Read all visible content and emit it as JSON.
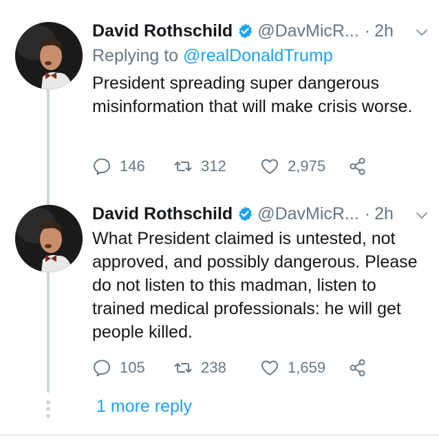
{
  "tweets": [
    {
      "author_name": "David Rothschild",
      "handle": "@DavMicR...",
      "separator": "·",
      "time": "2h",
      "replying_prefix": "Replying to ",
      "replying_to": "@realDonaldTrump",
      "text": "President spreading super dangerous misinformation that will make crisis worse.",
      "replies": "146",
      "retweets": "312",
      "likes": "2,975"
    },
    {
      "author_name": "David Rothschild",
      "handle": "@DavMicR...",
      "separator": "·",
      "time": "2h",
      "text": "What President claimed is untested, not approved, and possibly dangerous. Please do not listen to this madman, listen to trained medical professionals: he will get people killed.",
      "replies": "105",
      "retweets": "238",
      "likes": "1,659"
    }
  ],
  "more_replies_label": "1 more reply",
  "colors": {
    "link_blue": "#1da1f2",
    "secondary_gray": "#657786",
    "text_dark": "#14171a",
    "thread_line": "#ccd6dd"
  },
  "icons": [
    "verified-badge-icon",
    "chevron-down-icon",
    "reply-icon",
    "retweet-icon",
    "like-icon",
    "share-icon"
  ]
}
